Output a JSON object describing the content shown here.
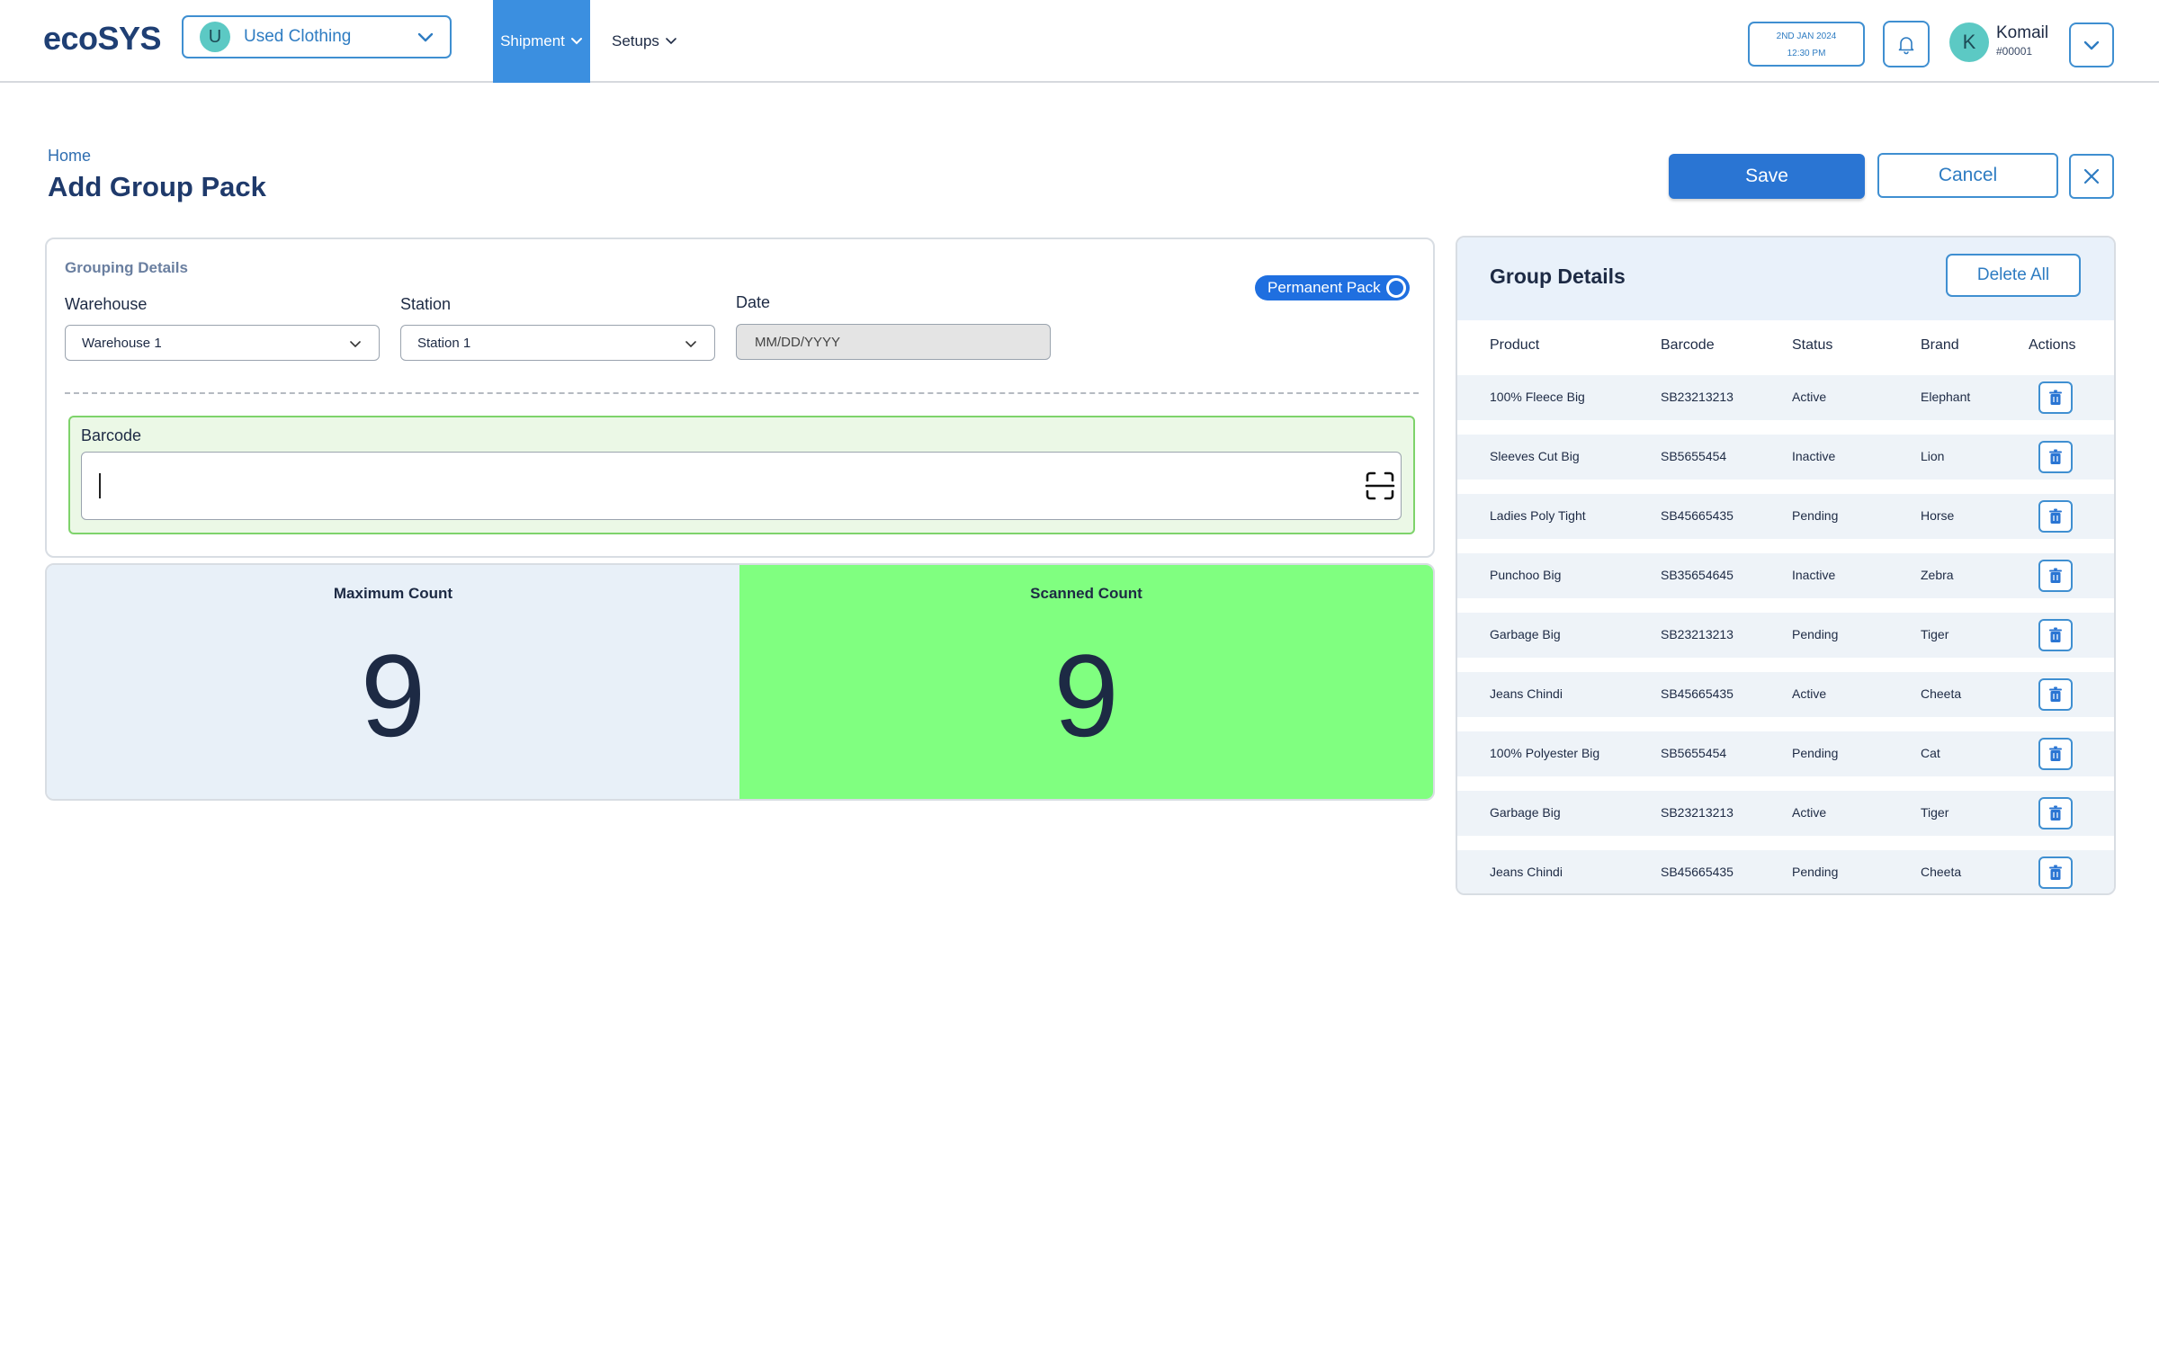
{
  "app": {
    "logo": "ecoSYS"
  },
  "org": {
    "avatar_letter": "U",
    "name": "Used Clothing"
  },
  "nav": {
    "shipment": "Shipment",
    "setups": "Setups"
  },
  "datetime": {
    "date": "2ND JAN 2024",
    "time": "12:30 PM"
  },
  "user": {
    "avatar_letter": "K",
    "name": "Komail",
    "id": "#00001"
  },
  "page": {
    "breadcrumb": "Home",
    "title": "Add Group Pack"
  },
  "actions": {
    "save": "Save",
    "cancel": "Cancel"
  },
  "grouping": {
    "title": "Grouping Details",
    "warehouse_label": "Warehouse",
    "warehouse_value": "Warehouse 1",
    "station_label": "Station",
    "station_value": "Station 1",
    "date_label": "Date",
    "date_placeholder": "MM/DD/YYYY",
    "permanent_pack": "Permanent Pack",
    "barcode_label": "Barcode"
  },
  "counts": {
    "max_label": "Maximum Count",
    "max_value": "9",
    "scanned_label": "Scanned Count",
    "scanned_value": "9"
  },
  "group_details": {
    "title": "Group Details",
    "delete_all": "Delete All",
    "columns": [
      "Product",
      "Barcode",
      "Status",
      "Brand",
      "Actions"
    ],
    "rows": [
      {
        "product": "100% Fleece Big",
        "barcode": "SB23213213",
        "status": "Active",
        "brand": "Elephant"
      },
      {
        "product": "Sleeves Cut Big",
        "barcode": "SB5655454",
        "status": "Inactive",
        "brand": "Lion"
      },
      {
        "product": "Ladies Poly Tight",
        "barcode": "SB45665435",
        "status": "Pending",
        "brand": "Horse"
      },
      {
        "product": "Punchoo Big",
        "barcode": "SB35654645",
        "status": "Inactive",
        "brand": "Zebra"
      },
      {
        "product": "Garbage Big",
        "barcode": "SB23213213",
        "status": "Pending",
        "brand": "Tiger"
      },
      {
        "product": "Jeans Chindi",
        "barcode": "SB45665435",
        "status": "Active",
        "brand": "Cheeta"
      },
      {
        "product": "100% Polyester Big",
        "barcode": "SB5655454",
        "status": "Pending",
        "brand": "Cat"
      },
      {
        "product": "Garbage Big",
        "barcode": "SB23213213",
        "status": "Active",
        "brand": "Tiger"
      },
      {
        "product": "Jeans Chindi",
        "barcode": "SB45665435",
        "status": "Pending",
        "brand": "Cheeta"
      }
    ]
  },
  "colors": {
    "primary": "#2a75d3",
    "accent_border": "#3f8fd1",
    "scanned_bg": "#80ff80",
    "max_bg": "#e8f0f8",
    "barcode_bg": "#ebf8e6"
  },
  "icons": {
    "org_dropdown": "chevron-down-icon",
    "bell": "bell-icon",
    "user_menu": "chevron-down-icon",
    "close": "close-icon",
    "scan": "scan-icon",
    "row_action": "trash-icon"
  }
}
